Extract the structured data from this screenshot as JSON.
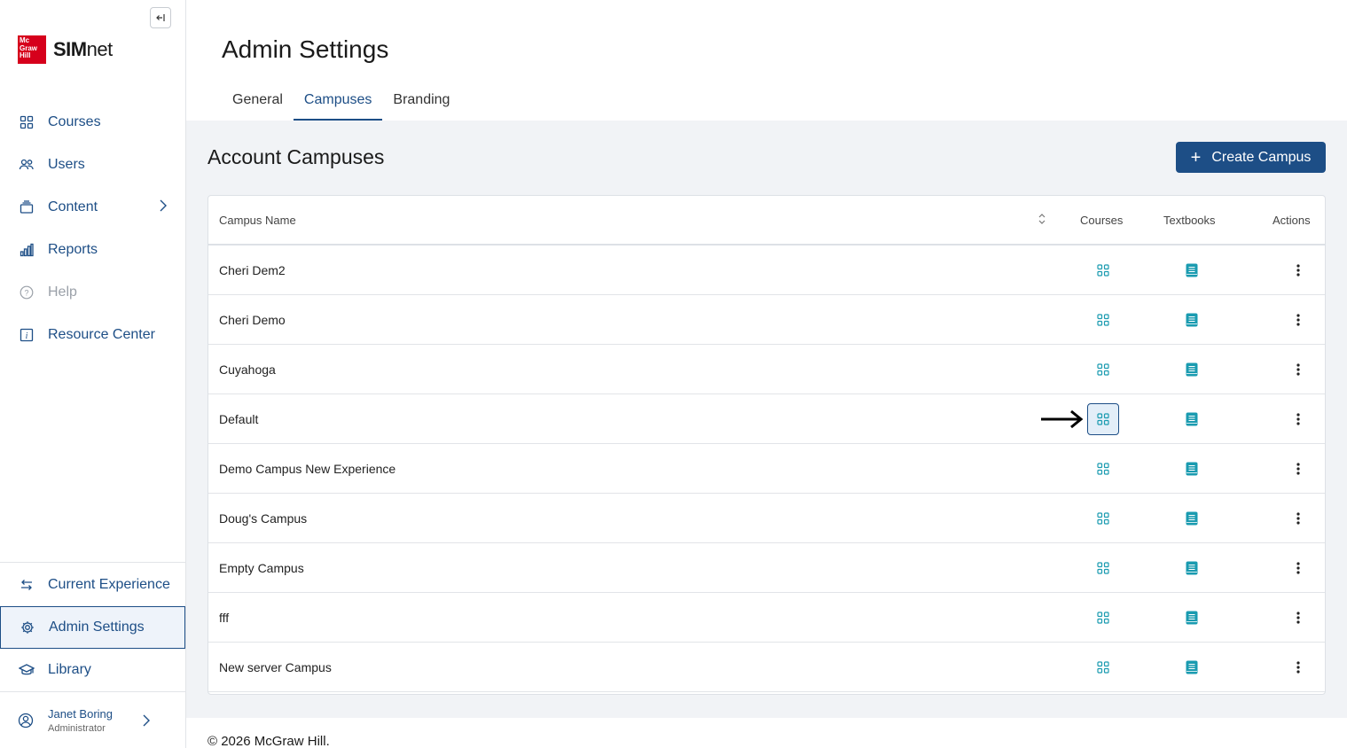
{
  "brand": {
    "logo_text": "Mc Graw Hill",
    "name_bold": "SIM",
    "name_light": "net"
  },
  "sidebar": {
    "items": [
      {
        "label": "Courses"
      },
      {
        "label": "Users"
      },
      {
        "label": "Content"
      },
      {
        "label": "Reports"
      },
      {
        "label": "Help"
      },
      {
        "label": "Resource Center"
      }
    ],
    "bottom_items": [
      {
        "label": "Current Experience"
      },
      {
        "label": "Admin Settings"
      },
      {
        "label": "Library"
      }
    ],
    "user": {
      "name": "Janet Boring",
      "role": "Administrator"
    }
  },
  "header": {
    "title": "Admin Settings",
    "tabs": [
      {
        "label": "General"
      },
      {
        "label": "Campuses"
      },
      {
        "label": "Branding"
      }
    ],
    "active_tab": "Campuses"
  },
  "content": {
    "title": "Account Campuses",
    "create_label": "Create Campus",
    "columns": {
      "name": "Campus Name",
      "courses": "Courses",
      "textbooks": "Textbooks",
      "actions": "Actions"
    },
    "rows": [
      {
        "name": "Cheri Dem2"
      },
      {
        "name": "Cheri Demo"
      },
      {
        "name": "Cuyahoga"
      },
      {
        "name": "Default"
      },
      {
        "name": "Demo Campus New Experience"
      },
      {
        "name": "Doug's Campus"
      },
      {
        "name": "Empty Campus"
      },
      {
        "name": "fff"
      },
      {
        "name": "New server Campus"
      }
    ]
  },
  "footer": {
    "copyright": "© 2026 McGraw Hill."
  },
  "colors": {
    "accent": "#1d4e86",
    "teal_icon": "#1a9bb0",
    "brand_red": "#d6001c"
  }
}
